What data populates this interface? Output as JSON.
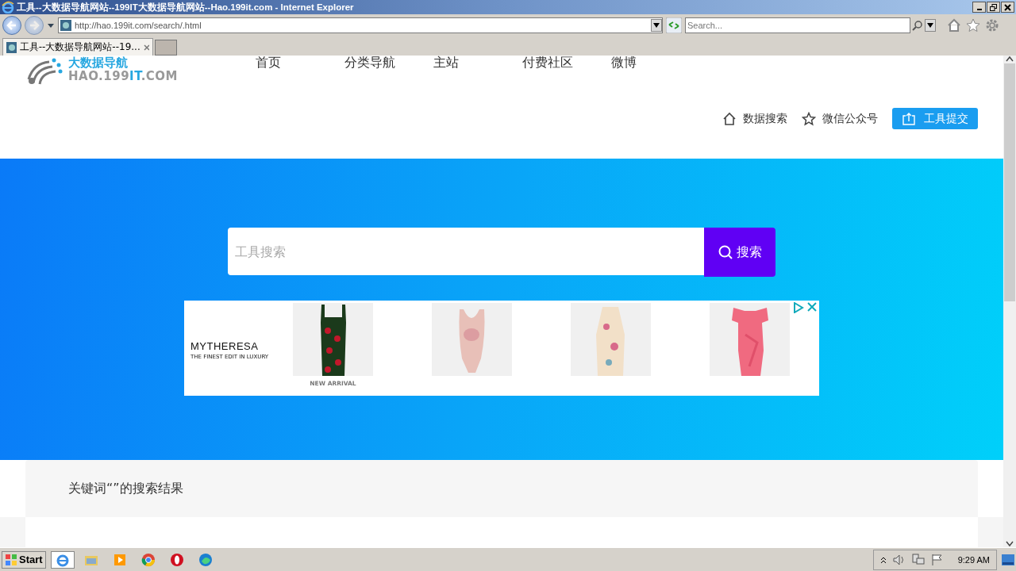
{
  "window": {
    "title": "工具--大数据导航网站--199IT大数据导航网站--Hao.199it.com - Internet Explorer"
  },
  "address_bar": {
    "url": "http://hao.199it.com/search/.html"
  },
  "browser_search": {
    "placeholder": "Search..."
  },
  "tabs": [
    {
      "label": "工具--大数据导航网站--19...",
      "selected": true
    }
  ],
  "logo": {
    "title": "大数据导航",
    "subtitle_parts": [
      {
        "text": "HAO.199",
        "kind": "plain"
      },
      {
        "text": "IT",
        "kind": "accent"
      },
      {
        "text": ".COM",
        "kind": "plain"
      }
    ]
  },
  "nav": [
    "首页",
    "分类导航",
    "主站",
    "付费社区",
    "微博"
  ],
  "actions": [
    {
      "label": "数据搜索",
      "kind": "link"
    },
    {
      "label": "微信公众号",
      "kind": "link"
    },
    {
      "label": "工具提交",
      "kind": "button"
    }
  ],
  "search": {
    "placeholder": "工具搜索",
    "button": "搜索"
  },
  "ad": {
    "brand": "MYTHERESA",
    "tagline": "THE FINEST EDIT IN LUXURY",
    "products": [
      {
        "caption": "NEW ARRIVAL",
        "kind": "picture"
      },
      {
        "kind": "picture"
      },
      {
        "kind": "picture"
      },
      {
        "kind": "picture"
      }
    ]
  },
  "results": {
    "heading": "关键词“”的搜索结果"
  },
  "taskbar": {
    "start": "Start",
    "clock": "9:29 AM"
  }
}
